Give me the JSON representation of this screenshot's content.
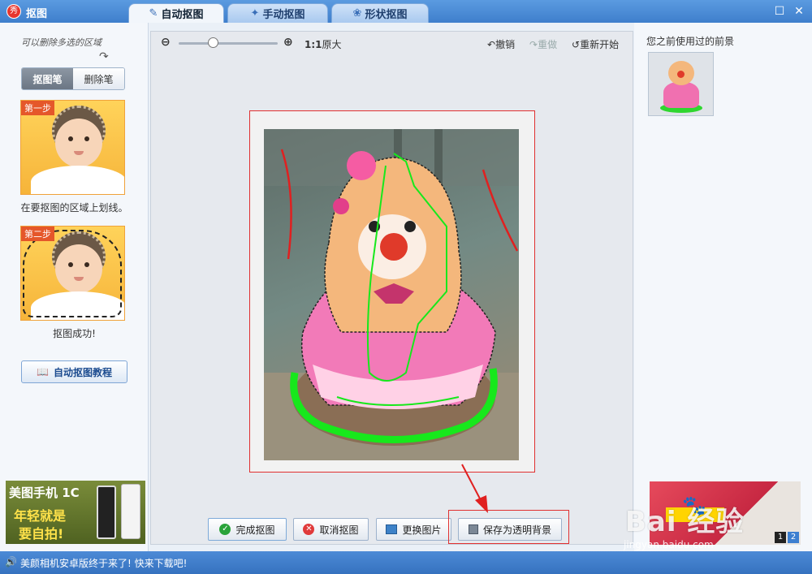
{
  "window": {
    "title": "抠图",
    "tabs": [
      {
        "label": "自动抠图",
        "icon": "brush-icon",
        "active": true
      },
      {
        "label": "手动抠图",
        "icon": "wand-icon",
        "active": false
      },
      {
        "label": "形状抠图",
        "icon": "shape-icon",
        "active": false
      }
    ]
  },
  "left_panel": {
    "hint": "可以删除多选的区域",
    "pen_tools": {
      "cutout_pen": "抠图笔",
      "eraser_pen": "删除笔"
    },
    "step1": {
      "badge": "第一步",
      "caption": "在要抠图的区域上划线。"
    },
    "step2": {
      "badge": "第二步",
      "caption": "抠图成功!"
    },
    "tutorial_button": "自动抠图教程",
    "ad": {
      "line1": "美图手机 1C",
      "line2": "年轻就是",
      "line3": "要自拍!"
    }
  },
  "toolbar": {
    "zoom_ratio": "1:1",
    "original_size": "原大",
    "zoom_level": 0.35,
    "undo": "撤销",
    "redo": "重做",
    "restart": "重新开始"
  },
  "actions": {
    "finish": "完成抠图",
    "cancel": "取消抠图",
    "replace": "更换图片",
    "save_transparent": "保存为透明背景"
  },
  "right_panel": {
    "title": "您之前使用过的前景",
    "ad_pages": [
      "1",
      "2"
    ],
    "current_page": "2"
  },
  "status": {
    "message": "美颜相机安卓版终于来了! 快来下载吧!"
  },
  "watermark": {
    "brand": "Bai 经验",
    "url": "jingyan.baidu.com"
  },
  "colors": {
    "accent": "#3f7fcc",
    "stroke_green": "#17e81c",
    "stroke_red": "#e02020",
    "highlight": "#e03030"
  }
}
